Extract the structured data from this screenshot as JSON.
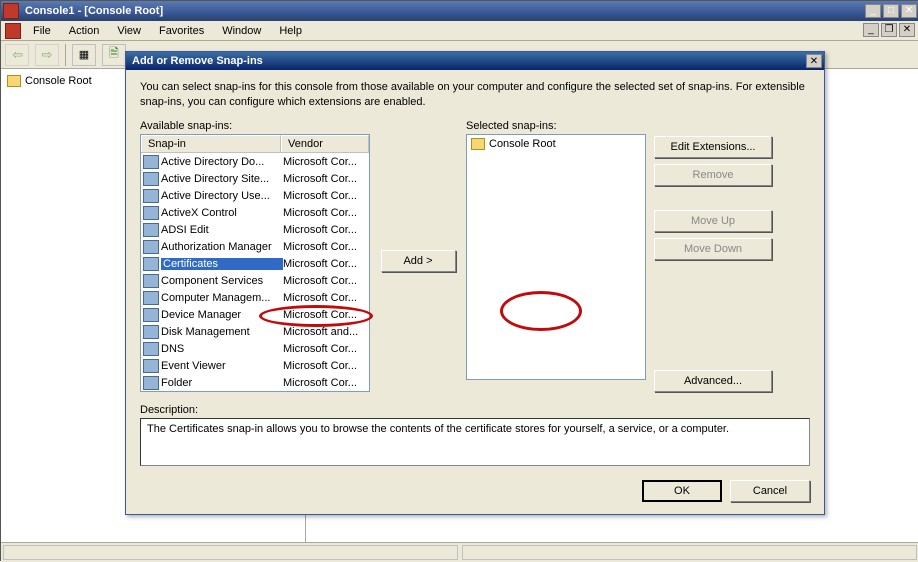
{
  "main": {
    "title": "Console1 - [Console Root]",
    "menus": [
      "File",
      "Action",
      "View",
      "Favorites",
      "Window",
      "Help"
    ],
    "tree_root": "Console Root"
  },
  "dialog": {
    "title": "Add or Remove Snap-ins",
    "intro": "You can select snap-ins for this console from those available on your computer and configure the selected set of snap-ins. For extensible snap-ins, you can configure which extensions are enabled.",
    "available_label": "Available snap-ins:",
    "selected_label": "Selected snap-ins:",
    "columns": {
      "snapin": "Snap-in",
      "vendor": "Vendor"
    },
    "snapins": [
      {
        "name": "Active Directory Do...",
        "vendor": "Microsoft Cor..."
      },
      {
        "name": "Active Directory Site...",
        "vendor": "Microsoft Cor..."
      },
      {
        "name": "Active Directory Use...",
        "vendor": "Microsoft Cor..."
      },
      {
        "name": "ActiveX Control",
        "vendor": "Microsoft Cor..."
      },
      {
        "name": "ADSI Edit",
        "vendor": "Microsoft Cor..."
      },
      {
        "name": "Authorization Manager",
        "vendor": "Microsoft Cor..."
      },
      {
        "name": "Certificates",
        "vendor": "Microsoft Cor..."
      },
      {
        "name": "Component Services",
        "vendor": "Microsoft Cor..."
      },
      {
        "name": "Computer Managem...",
        "vendor": "Microsoft Cor..."
      },
      {
        "name": "Device Manager",
        "vendor": "Microsoft Cor..."
      },
      {
        "name": "Disk Management",
        "vendor": "Microsoft and..."
      },
      {
        "name": "DNS",
        "vendor": "Microsoft Cor..."
      },
      {
        "name": "Event Viewer",
        "vendor": "Microsoft Cor..."
      },
      {
        "name": "Folder",
        "vendor": "Microsoft Cor..."
      }
    ],
    "selected_item": "Console Root",
    "buttons": {
      "add": "Add >",
      "edit_ext": "Edit Extensions...",
      "remove": "Remove",
      "move_up": "Move Up",
      "move_down": "Move Down",
      "advanced": "Advanced...",
      "ok": "OK",
      "cancel": "Cancel"
    },
    "description_label": "Description:",
    "description": "The Certificates snap-in allows you to browse the contents of the certificate stores for yourself, a service, or a computer."
  }
}
